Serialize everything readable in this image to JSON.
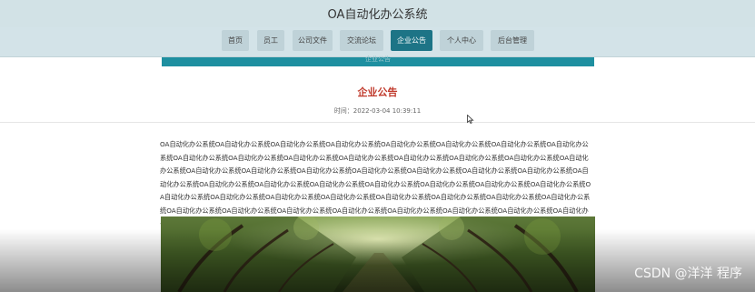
{
  "header": {
    "title": "OA自动化办公系统"
  },
  "nav": {
    "items": [
      {
        "label": "首页"
      },
      {
        "label": "员工"
      },
      {
        "label": "公司文件"
      },
      {
        "label": "交流论坛"
      },
      {
        "label": "企业公告",
        "active": true
      },
      {
        "label": "个人中心"
      },
      {
        "label": "后台管理"
      }
    ]
  },
  "banner": {
    "text": "企业公告"
  },
  "notice": {
    "title": "企业公告",
    "time": "时间：2022-03-04 10:39:11",
    "body": "OA自动化办公系统OA自动化办公系统OA自动化办公系统OA自动化办公系统OA自动化办公系统OA自动化办公系统OA自动化办公系统OA自动化办公系统OA自动化办公系统OA自动化办公系统OA自动化办公系统OA自动化办公系统OA自动化办公系统OA自动化办公系统OA自动化办公系统OA自动化办公系统OA自动化办公系统OA自动化办公系统OA自动化办公系统OA自动化办公系统OA自动化办公系统OA自动化办公系统OA自动化办公系统OA自动化办公系统OA自动化办公系统OA自动化办公系统OA自动化办公系统OA自动化办公系统OA自动化办公系统OA自动化办公系统OA自动化办公系统OA自动化办公系统OA自动化办公系统OA自动化办公系统OA自动化办公系统OA自动化办公系统OA自动化办公系统OA自动化办公系统OA自动化办公系统OA自动化办公系统OA自动化办公系统OA自动化办公系统OA自动化办公系统OA自动化办公系统OA自动化办公系统OA自动化办公系统OA自动化办公系统OA自动化办公系统OA自动化办公系统OA自动化办公系统OA自动化办公系统OA自动化办公系统OA自动化办公系统"
  },
  "watermark": "CSDN @洋洋 程序",
  "colors": {
    "header_bg": "#d2e2e6",
    "nav_bg": "#d3e3e8",
    "nav_active": "#1d7486",
    "title_red": "#c0392b",
    "banner_teal": "#1e8fa0"
  }
}
